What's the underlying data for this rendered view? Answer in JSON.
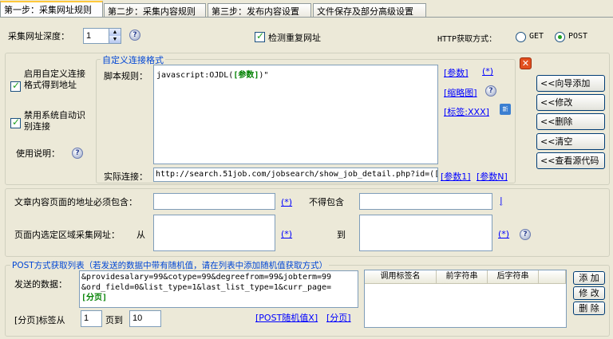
{
  "tabs": [
    "第一步：采集网址规则",
    "第二步：采集内容规则",
    "第三步：发布内容设置",
    "文件保存及部分高级设置"
  ],
  "depth": {
    "label": "采集网址深度：",
    "value": "1"
  },
  "check_duplicate": {
    "label": "检测重复网址",
    "checked": true
  },
  "http": {
    "label": "HTTP获取方式：",
    "options": [
      "GET",
      "POST"
    ],
    "selected": "POST"
  },
  "custom_link": {
    "enable_label": "启用自定义连接格式得到地址",
    "enable_checked": true,
    "disable_auto_label": "禁用系统自动识别连接",
    "disable_auto_checked": true,
    "usage_label": "使用说明：",
    "group_title": "自定义连接格式",
    "script_label": "脚本规则：",
    "script_prefix": "javascript:OJDL(",
    "script_token": "[参数]",
    "script_suffix": ")\"",
    "links": {
      "param": "[参数]",
      "wildcard": "(*)",
      "thumb": "[缩略图]",
      "tag": "[标签:XXX]"
    },
    "new_icon": "new-badge-icon",
    "actual_label": "实际连接：",
    "actual_value": "http://search.51job.com/jobsearch/show_job_detail.php?id=([",
    "param1": "[参数1]",
    "paramN": "[参数N]",
    "buttons": [
      "<<向导添加",
      "<<修改",
      "<<删除",
      "<<清空",
      "<<查看源代码"
    ]
  },
  "filters": {
    "must_contain_label": "文章内容页面的地址必须包含：",
    "must_contain_value": "",
    "wildcard": "(*)",
    "not_contain_label": "不得包含",
    "not_contain_value": "",
    "not_contain_link": "|",
    "region_label": "页面内选定区域采集网址：",
    "from_label": "从",
    "from_value": "",
    "to_label": "到",
    "to_value": ""
  },
  "post": {
    "group_title": "POST方式获取列表（若发送的数据中带有随机值，请在列表中添加随机值获取方式）",
    "send_label": "发送的数据：",
    "send_lines": [
      "&providesalary=99&cotype=99&degreefrom=99&jobterm=99",
      "&ord_field=0&list_type=1&last_list_type=1&curr_page="
    ],
    "send_token": "[分页]",
    "page_label": "[分页]标签从",
    "page_from": "1",
    "page_to_label": "页到",
    "page_to": "10",
    "random_link": "[POST随机值X]",
    "page_link": "[分页]",
    "table_headers": [
      "调用标签名",
      "前字符串",
      "后字符串"
    ],
    "buttons": [
      "添 加",
      "修 改",
      "删 除"
    ]
  },
  "colors": {
    "tab_active_accent": "#ffc83c",
    "group_title": "#0046d5",
    "link": "#0000ff",
    "token": "#008000",
    "close_button": "#e24f1f"
  }
}
